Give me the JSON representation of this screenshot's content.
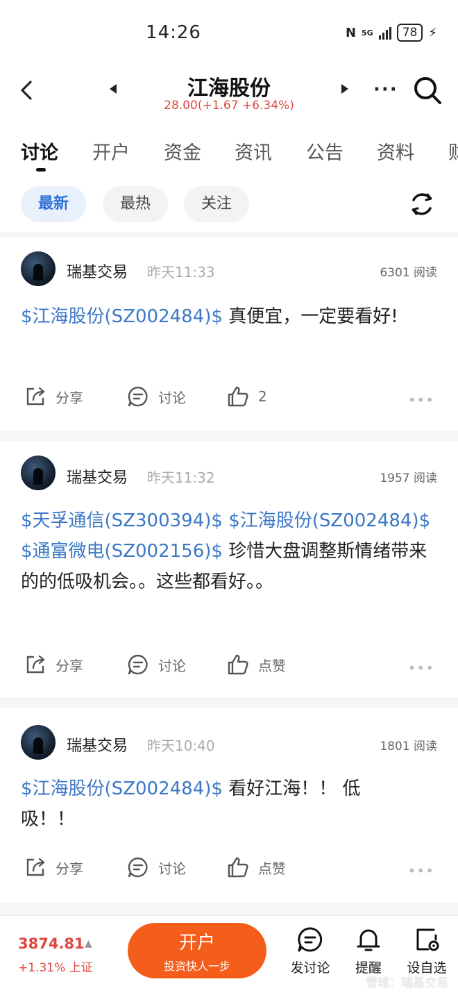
{
  "status_bar": {
    "time": "14:26",
    "network": "5G",
    "battery": "78"
  },
  "header": {
    "title": "江海股份",
    "price": "28.00(+1.67 +6.34%)",
    "more": "···"
  },
  "tabs": [
    "讨论",
    "开户",
    "资金",
    "资讯",
    "公告",
    "资料",
    "财"
  ],
  "filters": [
    "最新",
    "最热",
    "关注"
  ],
  "posts": [
    {
      "author": "瑞基交易",
      "time": "昨天11:33",
      "reads": "6301 阅读",
      "tags": [
        "$江海股份(SZ002484)$"
      ],
      "text": " 真便宜，一定要看好!",
      "share": "分享",
      "discuss": "讨论",
      "like": "2"
    },
    {
      "author": "瑞基交易",
      "time": "昨天11:32",
      "reads": "1957 阅读",
      "tags": [
        "$天孚通信(SZ300394)$",
        "$江海股份(SZ002484)$",
        "$通富微电(SZ002156)$"
      ],
      "text": " 珍惜大盘调整斯情绪带来的的低吸机会。。这些都看好。。",
      "share": "分享",
      "discuss": "讨论",
      "like": "点赞"
    },
    {
      "author": "瑞基交易",
      "time": "昨天10:40",
      "reads": "1801 阅读",
      "tags": [
        "$江海股份(SZ002484)$"
      ],
      "text": " 看好江海！！ 低吸！！",
      "share": "分享",
      "discuss": "讨论",
      "like": "点赞"
    }
  ],
  "bottom": {
    "index_value": "3874.81",
    "index_change": "+1.31% 上证",
    "open_title": "开户",
    "open_sub": "投资快人一步",
    "nav": [
      "发讨论",
      "提醒",
      "设自选"
    ],
    "watermark": "雪球：瑞基交易"
  },
  "colors": {
    "accent": "#3b77c6",
    "up": "#e0473e",
    "cta": "#f45d1a"
  }
}
